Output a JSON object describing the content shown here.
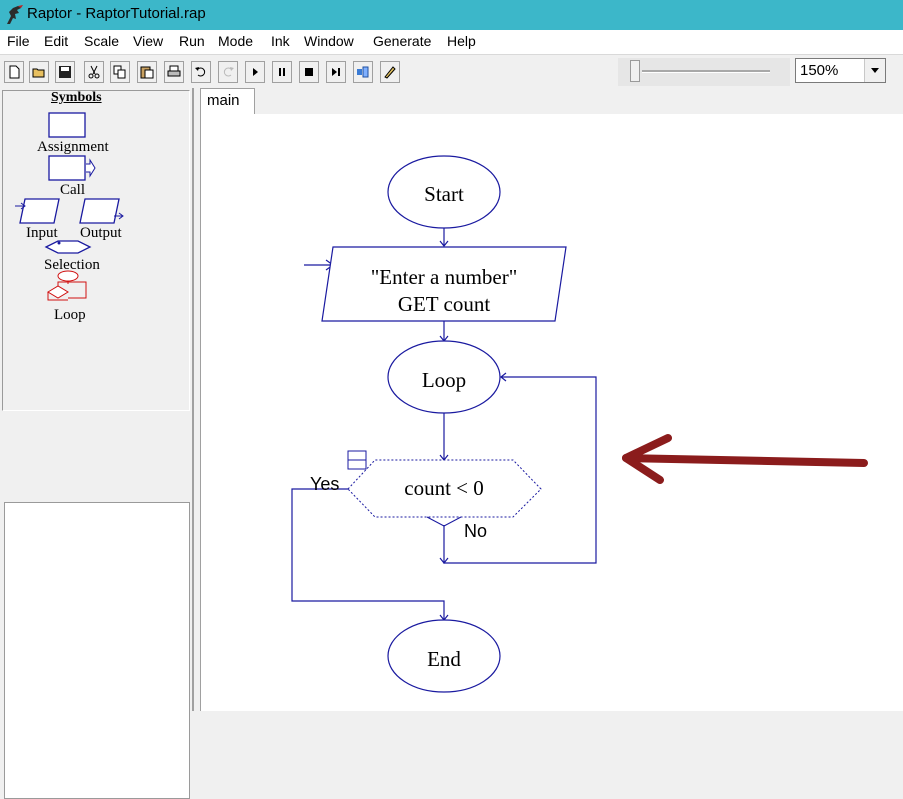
{
  "window": {
    "title": "Raptor - RaptorTutorial.rap"
  },
  "menu": [
    "File",
    "Edit",
    "Scale",
    "View",
    "Run",
    "Mode",
    "Ink",
    "Window",
    "Generate",
    "Help"
  ],
  "toolbar": {
    "buttons": [
      "new-icon",
      "open-icon",
      "save-icon",
      "cut-icon",
      "copy-icon",
      "paste-icon",
      "print-icon",
      "undo-icon",
      "redo-icon",
      "play-icon",
      "pause-icon",
      "stop-icon",
      "step-icon",
      "run-to-completion-icon",
      "ink-pen-icon"
    ],
    "speed_slider_level": 0.05,
    "zoom": "150%"
  },
  "symbols": {
    "title": "Symbols",
    "items": {
      "assignment": "Assignment",
      "call": "Call",
      "input": "Input",
      "output": "Output",
      "selection": "Selection",
      "loop": "Loop"
    }
  },
  "tabs": [
    "main"
  ],
  "flowchart": {
    "start": "Start",
    "input_prompt": "\"Enter a number\"",
    "input_get": "GET count",
    "loop": "Loop",
    "condition": "count < 0",
    "yes": "Yes",
    "no": "No",
    "end": "End"
  },
  "colors": {
    "titlebar": "#3cb7c9",
    "flowchart_line": "#1a1aa0",
    "loop_symbol": "#d01010",
    "annotation_arrow": "#8b1c1c"
  }
}
